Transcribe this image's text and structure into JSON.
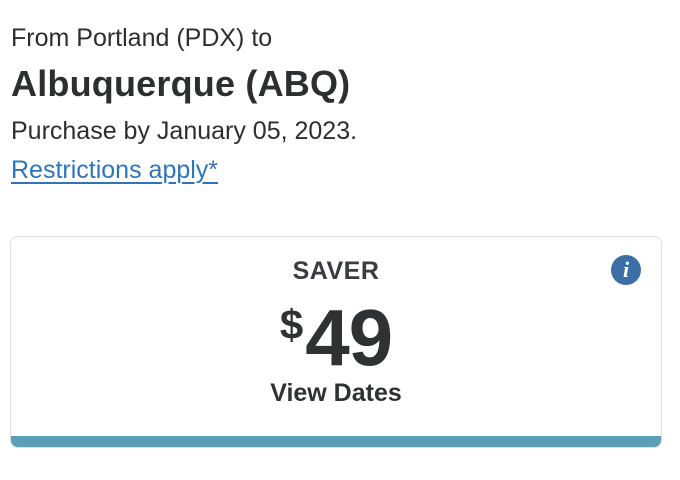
{
  "route": {
    "from_line": "From Portland (PDX) to",
    "destination": "Albuquerque (ABQ)",
    "purchase_line": "Purchase by January 05, 2023.",
    "restrictions_link": "Restrictions apply*"
  },
  "fare_card": {
    "title": "SAVER",
    "currency": "$",
    "amount": "49",
    "view_dates_label": "View Dates",
    "info_icon": "info-icon",
    "info_glyph": "i"
  },
  "colors": {
    "link": "#2f74b6",
    "info_icon": "#3b6fa6",
    "accent_bar": "#5a9fb7"
  }
}
